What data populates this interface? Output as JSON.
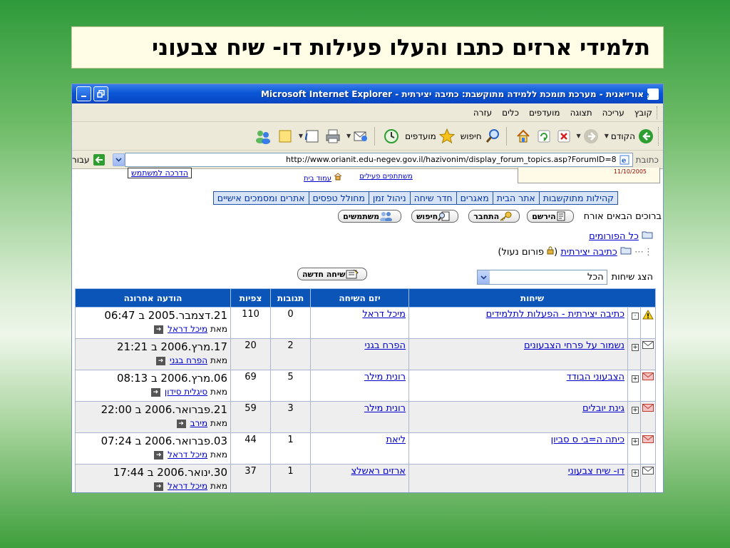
{
  "slide_title": "תלמידי ארזים כתבו והעלו פעילות  דו- שיח צבעוני",
  "window": {
    "title": "אורייאנית - מערכת תומכת ללמידה מתוקשבת: כתיבה יצירתית - Microsoft Internet Explorer"
  },
  "menu": [
    "קובץ",
    "עריכה",
    "תצוגה",
    "מועדפים",
    "כלים",
    "עזרה"
  ],
  "toolbar": {
    "back": "הקודם",
    "search": "חיפוש",
    "favorites": "מועדפים"
  },
  "address": {
    "label": "כתובת",
    "url": "http://www.orianit.edu-negev.gov.il/hazivonim/display_forum_topics.asp?ForumID=8",
    "go": "עבור"
  },
  "page": {
    "help_link": "הדרכה למשתמש",
    "home_link": "עמוד בית",
    "active_users_link": "משתתפים פעילים",
    "top_right_date": "11/10/2005",
    "nav_tabs": [
      "קהילות מתוקשבות",
      "אתר הבית",
      "מאגרים",
      "חדר שיחה",
      "ניהול זמן",
      "מחולל טפסים",
      "אתרים ומסמכים אישיים"
    ],
    "welcome": "ברוכים הבאים אורח",
    "buttons": {
      "register": "הירשם",
      "login": "התחבר",
      "search": "חיפוש",
      "users": "משתמשים",
      "new_topic": "שיחה חדשה"
    },
    "all_forums": "כל הפורומים",
    "forum_name": "כתיבה יצירתית",
    "forum_locked": "פורום נעול",
    "show_topics_label": "הצג שיחות",
    "show_topics_value": "הכל",
    "by_prefix": "מאת",
    "columns": [
      "שיחות",
      "יזם השיחה",
      "תגובות",
      "צפיות",
      "הודעה אחרונה"
    ],
    "topics": [
      {
        "status": "warning-icon",
        "subject": "כתיבה יצירתית - הפעלות לתלמידים",
        "author": "מיכל דראל",
        "replies": "0",
        "views": "110",
        "last_date": "21.דצמבר.2005 ב 06:47",
        "last_by": "מיכל דראל"
      },
      {
        "status": "envelope-icon",
        "subject": "נשמור על פרחי הצבעונים",
        "author": "הפרח בגני",
        "replies": "2",
        "views": "20",
        "last_date": "17.מרץ.2006 ב 21:21",
        "last_by": "הפרח בגני"
      },
      {
        "status": "envelope-red-icon",
        "subject": "הצבעוני הבודד",
        "author": "רונית מילר",
        "replies": "5",
        "views": "69",
        "last_date": "06.מרץ.2006 ב 08:13",
        "last_by": "סיגלית סידון"
      },
      {
        "status": "envelope-red-icon",
        "subject": "גינת יובלים",
        "author": "רונית מילר",
        "replies": "3",
        "views": "59",
        "last_date": "21.פברואר.2006 ב 22:00",
        "last_by": "מירב"
      },
      {
        "status": "envelope-red-icon",
        "subject": "כיתה ה=בי ס סביון",
        "author": "ליאת",
        "replies": "1",
        "views": "44",
        "last_date": "03.פברואר.2006 ב 07:24",
        "last_by": "מיכל דראל"
      },
      {
        "status": "envelope-icon",
        "subject": "דו- שיח צבעוני",
        "author": "ארזים ראשלצ",
        "replies": "1",
        "views": "37",
        "last_date": "30.ינואר.2006 ב 17:44",
        "last_by": "מיכל דראל"
      }
    ]
  }
}
